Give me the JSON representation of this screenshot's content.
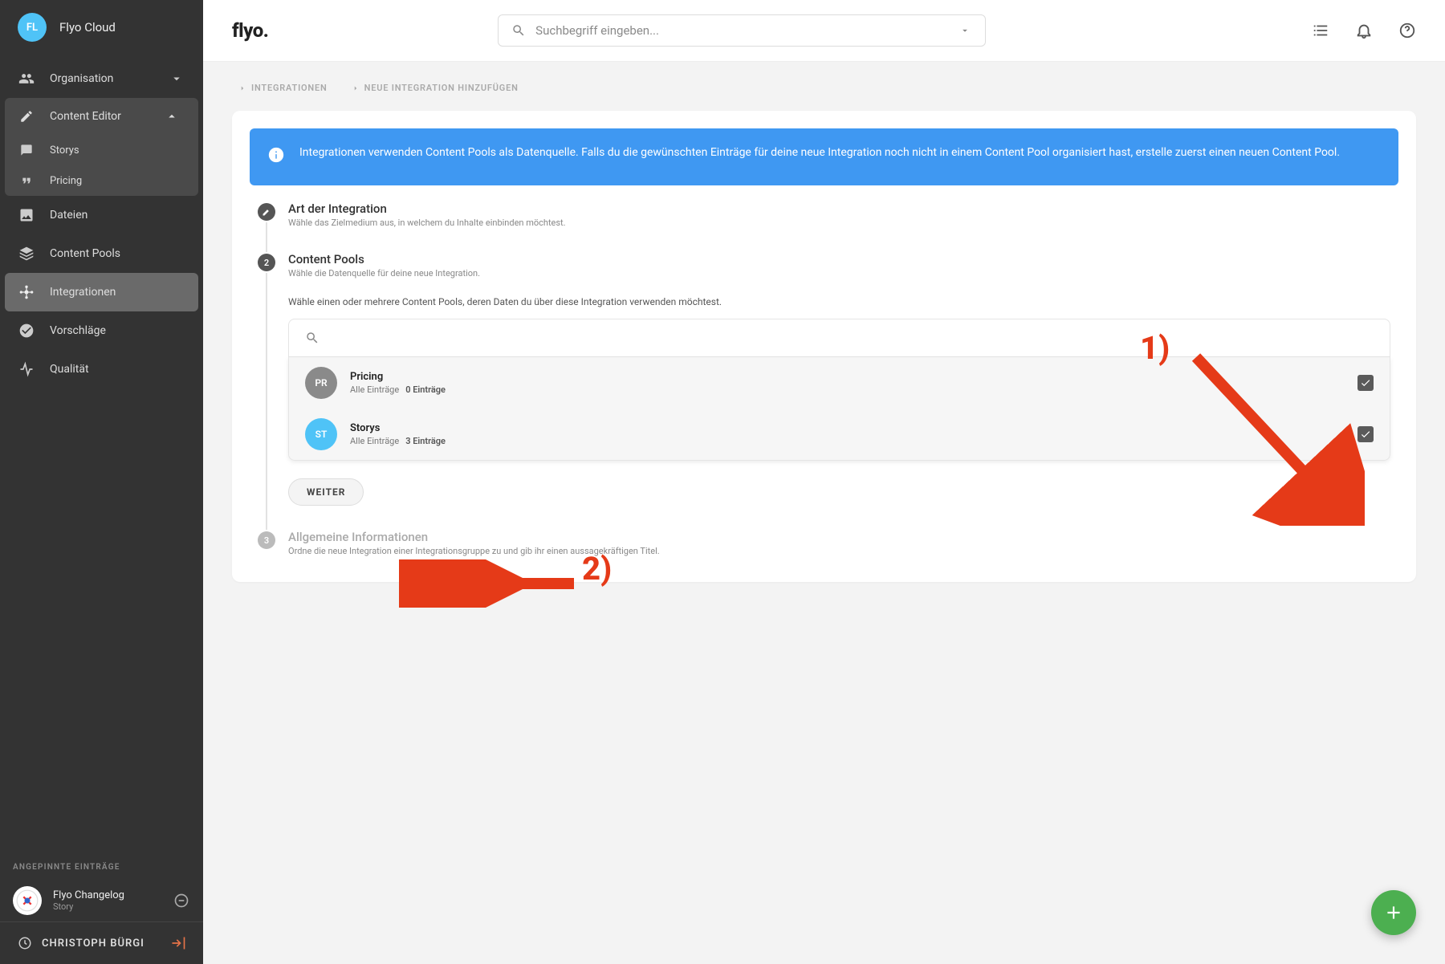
{
  "org": {
    "initials": "FL",
    "name": "Flyo Cloud"
  },
  "sidebar": {
    "organisation": "Organisation",
    "contentEditor": "Content Editor",
    "sub": {
      "storys": "Storys",
      "pricing": "Pricing"
    },
    "dateien": "Dateien",
    "contentPools": "Content Pools",
    "integrationen": "Integrationen",
    "vorschlaege": "Vorschläge",
    "qualitaet": "Qualität",
    "pinnedTitle": "ANGEPINNTE EINTRÄGE",
    "pinned": {
      "title": "Flyo Changelog",
      "sub": "Story"
    },
    "user": "CHRISTOPH BÜRGI"
  },
  "header": {
    "logo": "flyo.",
    "searchPlaceholder": "Suchbegriff eingeben..."
  },
  "breadcrumbs": {
    "a": "INTEGRATIONEN",
    "b": "NEUE INTEGRATION HINZUFÜGEN"
  },
  "banner": "Integrationen verwenden Content Pools als Datenquelle. Falls du die gewünschten Einträge für deine neue Integration noch nicht in einem Content Pool organisiert hast, erstelle zuerst einen neuen Content Pool.",
  "steps": {
    "s1": {
      "title": "Art der Integration",
      "sub": "Wähle das Zielmedium aus, in welchem du Inhalte einbinden möchtest."
    },
    "s2": {
      "title": "Content Pools",
      "sub": "Wähle die Datenquelle für deine neue Integration.",
      "hint": "Wähle einen oder mehrere Content Pools, deren Daten du über diese Integration verwenden möchtest."
    },
    "s3": {
      "title": "Allgemeine Informationen",
      "sub": "Ordne die neue Integration einer Integrationsgruppe zu und gib ihr einen aussagekräftigen Titel.",
      "num": "3"
    }
  },
  "pools": [
    {
      "av": "PR",
      "col": "#8a8a8a",
      "title": "Pricing",
      "sub": "Alle Einträge",
      "count": "0 Einträge"
    },
    {
      "av": "ST",
      "col": "#4fc3f7",
      "title": "Storys",
      "sub": "Alle Einträge",
      "count": "3 Einträge"
    }
  ],
  "buttons": {
    "next": "WEITER"
  },
  "anno": {
    "one": "1)",
    "two": "2)"
  },
  "stepper": {
    "num2": "2"
  }
}
